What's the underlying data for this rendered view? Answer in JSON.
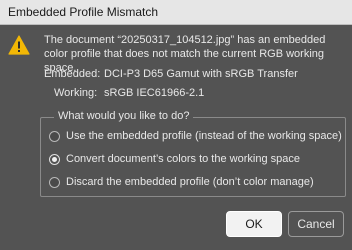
{
  "window": {
    "title": "Embedded Profile Mismatch"
  },
  "message": {
    "text": "The document “20250317_104512.jpg” has an embedded color profile that does not match the current RGB working space."
  },
  "profiles": {
    "embedded_label": "Embedded:",
    "embedded_value": "DCI-P3 D65 Gamut with sRGB Transfer",
    "working_label": "Working:",
    "working_value": "sRGB IEC61966-2.1"
  },
  "options": {
    "legend": "What would you like to do?",
    "items": [
      {
        "label": "Use the embedded profile (instead of the working space)",
        "checked": false
      },
      {
        "label": "Convert document’s colors to the working space",
        "checked": true
      },
      {
        "label": "Discard the embedded profile (don’t color manage)",
        "checked": false
      }
    ]
  },
  "buttons": {
    "ok": "OK",
    "cancel": "Cancel"
  },
  "icons": {
    "warning": "warning-triangle-icon"
  },
  "colors": {
    "dialog_bg": "#535353",
    "warning": "#f2b705",
    "text": "#e8e8e8"
  }
}
